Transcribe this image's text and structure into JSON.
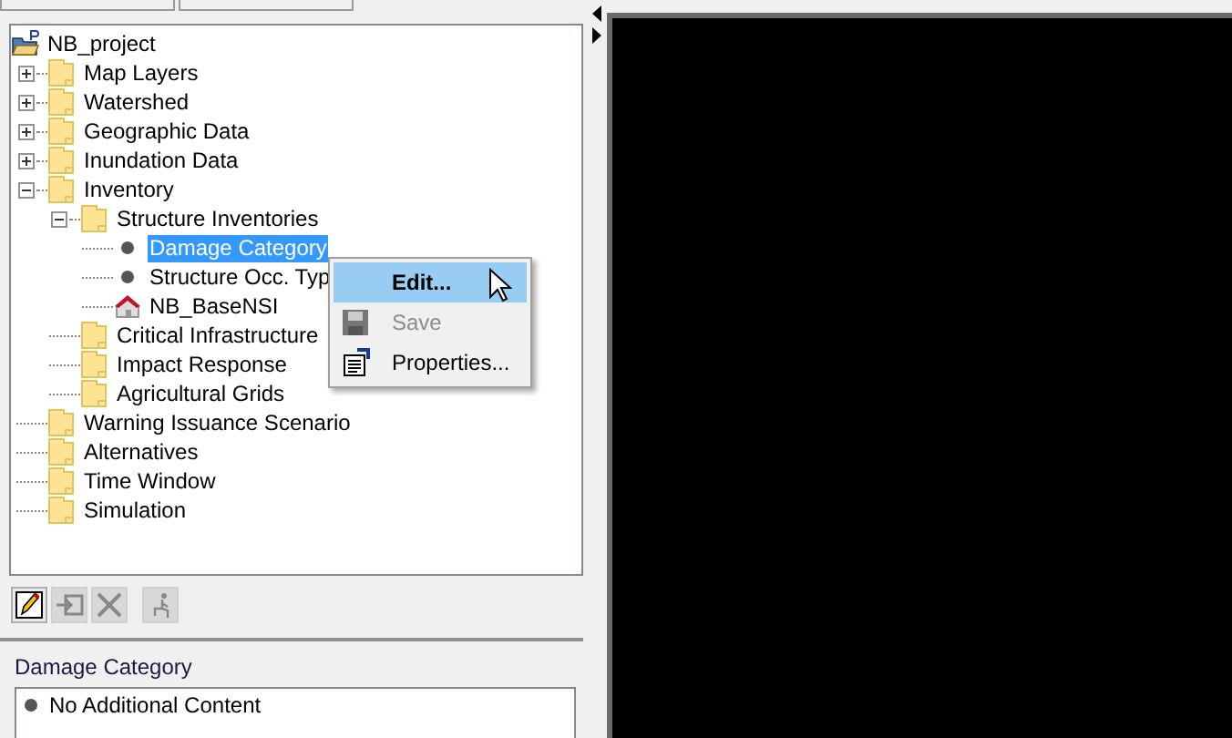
{
  "tree": {
    "label": "NB_project",
    "kind": "project",
    "selected": false,
    "children": [
      {
        "label": "Map Layers",
        "kind": "folder",
        "expanded": false,
        "selected": false
      },
      {
        "label": "Watershed",
        "kind": "folder",
        "expanded": false,
        "selected": false
      },
      {
        "label": "Geographic Data",
        "kind": "folder",
        "expanded": false,
        "selected": false
      },
      {
        "label": "Inundation Data",
        "kind": "folder",
        "expanded": false,
        "selected": false
      },
      {
        "label": "Inventory",
        "kind": "folder",
        "expanded": true,
        "selected": false,
        "children": [
          {
            "label": "Structure Inventories",
            "kind": "folder",
            "expanded": true,
            "selected": false,
            "children": [
              {
                "label": "Damage Category",
                "kind": "leaf",
                "selected": true
              },
              {
                "label": "Structure Occ. Typ",
                "kind": "leaf",
                "selected": false
              },
              {
                "label": "NB_BaseNSI",
                "kind": "dataset",
                "selected": false
              }
            ]
          },
          {
            "label": "Critical Infrastructure",
            "kind": "folder",
            "selected": false
          },
          {
            "label": "Impact Response",
            "kind": "folder",
            "selected": false
          },
          {
            "label": "Agricultural Grids",
            "kind": "folder",
            "selected": false
          }
        ]
      },
      {
        "label": "Warning Issuance Scenario",
        "kind": "folder",
        "selected": false
      },
      {
        "label": "Alternatives",
        "kind": "folder",
        "selected": false
      },
      {
        "label": "Time Window",
        "kind": "folder",
        "selected": false
      },
      {
        "label": "Simulation",
        "kind": "folder",
        "selected": false
      }
    ]
  },
  "context_menu": [
    {
      "label": "Edit...",
      "kind": "edit",
      "selected": true,
      "disabled": false
    },
    {
      "label": "Save",
      "kind": "save",
      "selected": false,
      "disabled": true
    },
    {
      "label": "Properties...",
      "kind": "properties",
      "selected": false,
      "disabled": false
    }
  ],
  "toolbar": [
    {
      "kind": "edit",
      "disabled": false
    },
    {
      "kind": "import",
      "disabled": true
    },
    {
      "kind": "delete",
      "disabled": true
    },
    {
      "kind": "run",
      "disabled": true
    }
  ],
  "details": {
    "title": "Damage Category",
    "items": [
      "No Additional Content"
    ]
  }
}
